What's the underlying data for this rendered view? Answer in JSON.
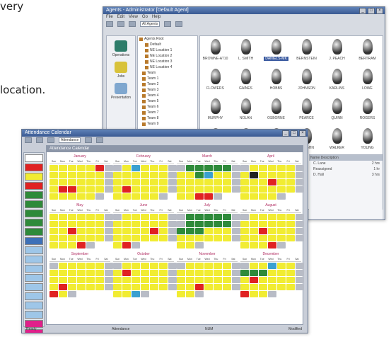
{
  "captions": {
    "top_fragment": "very",
    "location_line": "location."
  },
  "back_window": {
    "title": "Agents - Administrator [Default Agent]",
    "menu": [
      "File",
      "Edit",
      "View",
      "Go",
      "Help"
    ],
    "toolbar_field": "All Agents",
    "sidebar": [
      {
        "label": "Operations",
        "color": "#2e7d6a"
      },
      {
        "label": "Jobs",
        "color": "#d8c23a"
      },
      {
        "label": "Presentation",
        "color": "#7fa7cf"
      }
    ],
    "tree": [
      "Agents Root",
      "Default",
      "NE Location 1",
      "NE Location 2",
      "NE Location 3",
      "NE Location 4",
      "Team",
      "Team 1",
      "Team 2",
      "Team 3",
      "Team 4",
      "Team 5",
      "Team 6",
      "Team 7",
      "Team 8",
      "Team 9"
    ],
    "agents": [
      "BROWNE-AT10",
      "L. SMITH",
      "DANIELS-MK",
      "BERNSTEIN",
      "J. PEACH",
      "BERTRAM",
      "FLOWERS",
      "GAINES",
      "HOBBS",
      "JOHNSON",
      "KARLINS",
      "LOWE",
      "MURPHY",
      "NOLAN",
      "OSBORNE",
      "PEARCE",
      "QUINN",
      "ROGERS",
      "STEVENS",
      "TURNER",
      "UPTON",
      "VAUGHN",
      "WALKER",
      "YOUNG"
    ],
    "selected_agent_index": 2,
    "right_panel": {
      "header": "Name  Description",
      "rows": [
        [
          "C. Lane",
          "2 hrs"
        ],
        [
          "Reassigned",
          "1 hr"
        ],
        [
          "D. Hall",
          "3 hrs"
        ]
      ]
    }
  },
  "front_window": {
    "title": "Attendance Calendar",
    "menu": [
      "File",
      "Edit",
      "View",
      "Help"
    ],
    "toolbar_field": "Attendance",
    "calendar_header": "Attendance Calendar",
    "left_items": [
      {
        "label": "",
        "color": "#ffffff"
      },
      {
        "label": "",
        "color": "#e02222"
      },
      {
        "label": "",
        "color": "#f1ec32"
      },
      {
        "label": "",
        "color": "#e02222"
      },
      {
        "label": "",
        "color": "#2e8a3a"
      },
      {
        "label": "",
        "color": "#2e8a3a"
      },
      {
        "label": "",
        "color": "#2e8a3a"
      },
      {
        "label": "",
        "color": "#2e8a3a"
      },
      {
        "label": "",
        "color": "#2e8a3a"
      },
      {
        "label": "",
        "color": "#3d70b8"
      },
      {
        "label": "",
        "color": "#9ec6e8"
      },
      {
        "label": "",
        "color": "#9ec6e8"
      },
      {
        "label": "",
        "color": "#9ec6e8"
      },
      {
        "label": "",
        "color": "#9ec6e8"
      },
      {
        "label": "",
        "color": "#9ec6e8"
      },
      {
        "label": "",
        "color": "#9ec6e8"
      },
      {
        "label": "",
        "color": "#9ec6e8"
      },
      {
        "label": "",
        "color": "#9ec6e8"
      },
      {
        "label": "",
        "color": "#e0208a"
      },
      {
        "label": "",
        "color": "#e0208a"
      }
    ],
    "months": [
      {
        "name": "January",
        "pattern": "yyyyyrs yyyyyys yyyyyys yrryyys yyyyys"
      },
      {
        "name": "February",
        "pattern": "sybyyys yyyyyys yyyyyys yryyyys yyyyys"
      },
      {
        "name": "March",
        "pattern": "sgggggs yygbyys yyyyyys yyyyyys yyrrs"
      },
      {
        "name": "April",
        "pattern": "syyyyys ykyyyys yyyryys yyyyyys yyyys"
      },
      {
        "name": "May",
        "pattern": "yyyyyys yyyyyys yyryyys yyyyyys yyyrs"
      },
      {
        "name": "June",
        "pattern": "syyyyys yyyyyys yyyyrys yyyyyys yrs"
      },
      {
        "name": "July",
        "pattern": "sgggggs sgggggs gggyyys yyyyyys yys"
      },
      {
        "name": "August",
        "pattern": "syyyyys yyyyyys yyryyys yyyyyys yyyrs"
      },
      {
        "name": "September",
        "pattern": "syyyyys yyyyyys yyyyyys yryyyys rys"
      },
      {
        "name": "October",
        "pattern": "syyyyys yryyyys yyyyyys yyyyyys yybs"
      },
      {
        "name": "November",
        "pattern": "syyyyys yyyyyys yyyyyys yyryyys yys"
      },
      {
        "name": "December",
        "pattern": "syybyys gggyyys yryyyys yyyyyys ryys"
      }
    ],
    "weekdays": [
      "Sun",
      "Mon",
      "Tue",
      "Wed",
      "Thu",
      "Fri",
      "Sat"
    ],
    "status": [
      "Ready",
      "Attendance",
      "NUM",
      "Modified"
    ]
  }
}
